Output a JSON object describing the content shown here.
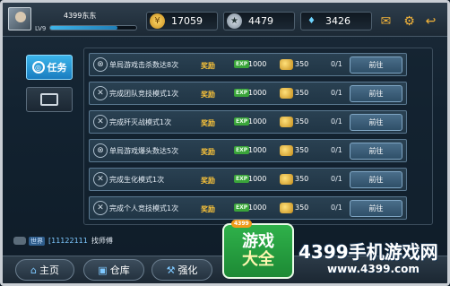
{
  "player": {
    "name": "4399东东",
    "level": "LV9",
    "xp_fraction": 0.78
  },
  "currencies": {
    "gold": "17059",
    "honor": "4479",
    "diamond": "3426"
  },
  "tabs": {
    "tasks": "任务"
  },
  "task_labels": {
    "reward": "奖励",
    "exp_tag": "EXP",
    "go": "前往"
  },
  "tasks": [
    {
      "title": "单局游戏击杀数达8次",
      "exp": "1000",
      "gold": "350",
      "progress": "0/1"
    },
    {
      "title": "完成团队竞技模式1次",
      "exp": "1000",
      "gold": "350",
      "progress": "0/1"
    },
    {
      "title": "完成歼灭战模式1次",
      "exp": "1000",
      "gold": "350",
      "progress": "0/1"
    },
    {
      "title": "单局游戏爆头数达5次",
      "exp": "1000",
      "gold": "350",
      "progress": "0/1"
    },
    {
      "title": "完成生化模式1次",
      "exp": "1000",
      "gold": "350",
      "progress": "0/1"
    },
    {
      "title": "完成个人竞技模式1次",
      "exp": "1000",
      "gold": "350",
      "progress": "0/1"
    }
  ],
  "chat": {
    "channel": "世界",
    "user": "[11122111",
    "message": "找师傅"
  },
  "bottom_nav": {
    "home": "主页",
    "warehouse": "仓库",
    "upgrade": "强化"
  },
  "watermark": {
    "badge": "4399",
    "line1": "游戏",
    "line2": "大全",
    "site_name": "4399手机游戏网",
    "url": "www.4399.com"
  }
}
